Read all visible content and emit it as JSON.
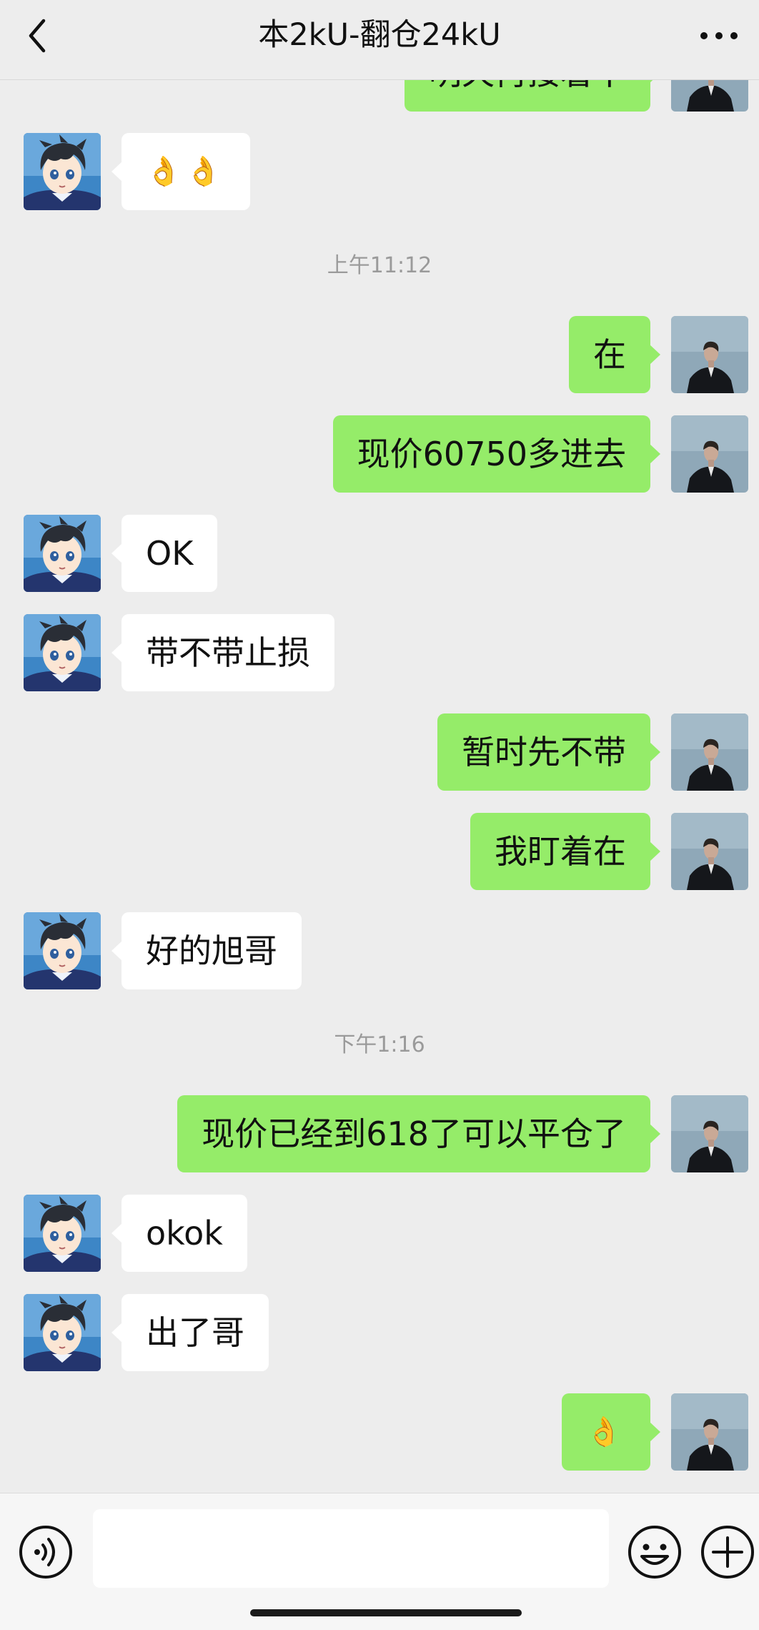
{
  "header": {
    "title": "本2kU-翻仓24kU"
  },
  "chat": {
    "timestamps": [
      "上午11:12",
      "下午1:16"
    ],
    "messages": [
      {
        "side": "right",
        "text": "明天再接着干"
      },
      {
        "side": "left",
        "text": "👌👌"
      },
      {
        "side": "right",
        "text": "在"
      },
      {
        "side": "right",
        "text": "现价60750多进去"
      },
      {
        "side": "left",
        "text": "OK"
      },
      {
        "side": "left",
        "text": "带不带止损"
      },
      {
        "side": "right",
        "text": "暂时先不带"
      },
      {
        "side": "right",
        "text": "我盯着在"
      },
      {
        "side": "left",
        "text": "好的旭哥"
      },
      {
        "side": "right",
        "text": "现价已经到618了可以平仓了"
      },
      {
        "side": "left",
        "text": "okok"
      },
      {
        "side": "left",
        "text": "出了哥"
      },
      {
        "side": "right",
        "text": "👌"
      }
    ]
  },
  "input": {
    "value": "",
    "placeholder": ""
  },
  "icons": {
    "back": "chevron-left-icon",
    "more": "more-dots-icon",
    "voice": "voice-icon",
    "emoji": "smiley-icon",
    "plus": "plus-icon"
  },
  "colors": {
    "background": "#ededed",
    "outgoing_bubble": "#95ec69",
    "incoming_bubble": "#ffffff",
    "timestamp_text": "#9a9a9a"
  }
}
